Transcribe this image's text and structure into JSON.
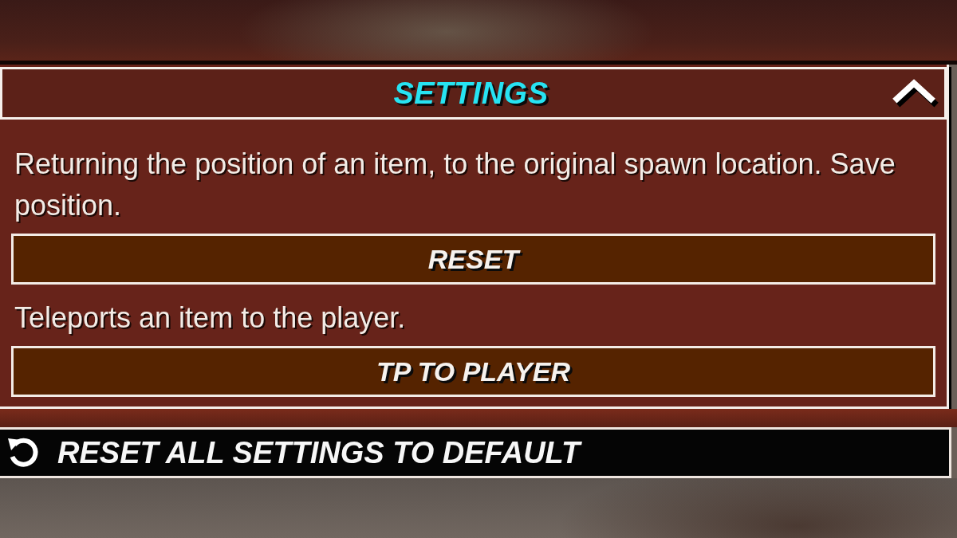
{
  "settings_panel": {
    "title": "SETTINGS",
    "expanded": true,
    "options": [
      {
        "description": "Returning the position of an item, to the original spawn location. Save position.",
        "button": "RESET"
      },
      {
        "description": "Teleports an item to the player.",
        "button": "TP TO PLAYER"
      }
    ]
  },
  "reset_all_button": {
    "label": "RESET ALL SETTINGS TO DEFAULT"
  }
}
